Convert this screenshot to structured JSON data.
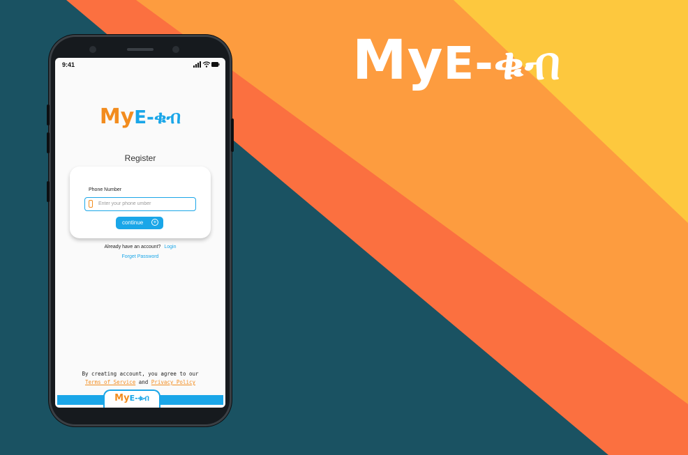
{
  "brand": {
    "logo_main": "My",
    "logo_rest": "E-ቁብ",
    "colors": {
      "orange": "#f28c1e",
      "blue": "#1aa6e8",
      "teal": "#1a5262",
      "coral": "#fb7040",
      "amber": "#fd9c3f",
      "yellow": "#fdc83e"
    }
  },
  "status_bar": {
    "time": "9:41"
  },
  "register": {
    "title": "Register",
    "phone_label": "Phone Number",
    "phone_placeholder": "Enter your phone umber",
    "phone_value": "",
    "continue_label": "continue"
  },
  "account": {
    "have_account": "Already have an account?",
    "login_link": "Login",
    "forget_password": "Forget Password"
  },
  "terms": {
    "line1": "By creating account, you agree to our",
    "tos_link": "Terms of Service",
    "and_text": "and",
    "privacy_link": "Privacy Policy"
  },
  "icons": [
    "signal-icon",
    "wifi-icon",
    "battery-icon",
    "phone-icon",
    "plus-circle-icon"
  ]
}
